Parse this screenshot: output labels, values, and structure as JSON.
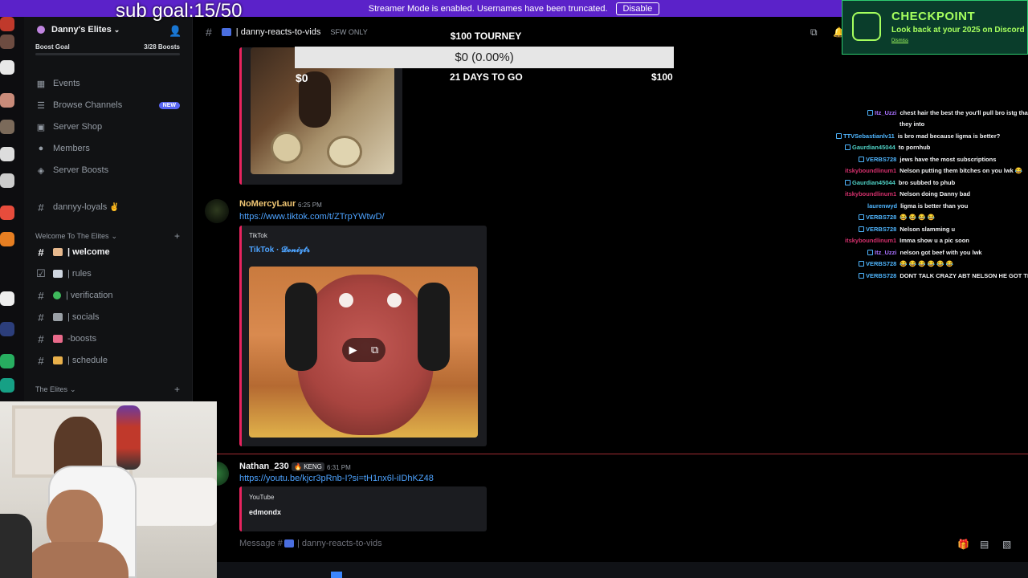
{
  "banner": {
    "text": "Streamer Mode is enabled. Usernames have been truncated.",
    "disable_label": "Disable"
  },
  "overlay": {
    "sub_goal": "sub goal:15/50",
    "tourney_title": "$100 TOURNEY",
    "tourney_amount": "$0 (0.00%)",
    "tourney_min": "$0",
    "tourney_days": "21 DAYS TO GO",
    "tourney_max": "$100"
  },
  "server": {
    "name": "Danny's Elites",
    "boost_goal_label": "Boost Goal",
    "boost_count": "3/28 Boosts",
    "nav": [
      {
        "label": "Events",
        "icon": "calendar-icon"
      },
      {
        "label": "Browse Channels",
        "icon": "browse-icon",
        "badge": "NEW"
      },
      {
        "label": "Server Shop",
        "icon": "shop-icon"
      },
      {
        "label": "Members",
        "icon": "members-icon"
      },
      {
        "label": "Server Boosts",
        "icon": "boost-icon"
      }
    ],
    "loyals_channel": "dannyy-loyals",
    "category_welcome": "Welcome To The Elites",
    "channels": [
      {
        "label": "| welcome",
        "active": true,
        "emoji_color": "#e7b98e"
      },
      {
        "label": "| rules",
        "emoji_color": "#cfd6e0"
      },
      {
        "label": "| verification",
        "emoji_color": "#3fba5d"
      },
      {
        "label": "| socials",
        "emoji_color": "#9aa0a6"
      },
      {
        "label": "-boosts",
        "emoji_color": "#e96a8a"
      },
      {
        "label": "| schedule",
        "emoji_color": "#e9b04a"
      }
    ],
    "category_elites": "The Elites"
  },
  "header": {
    "channel_name": "| danny-reacts-to-vids",
    "sfw": "SFW ONLY"
  },
  "messages": [
    {
      "author": "NoMercyLaur",
      "author_color": "#f0c674",
      "time": "6:25 PM",
      "link": "https://www.tiktok.com/t/ZTrpYWtwD/",
      "embed_provider": "TikTok",
      "embed_title": "TikTok · 𝓓𝓸𝓷𝓲𝔃𝓽𝓻"
    },
    {
      "author": "Nathan_230",
      "author_color": "#f2f3f5",
      "tag": "KENG",
      "time": "6:31 PM",
      "link": "https://youtu.be/kjcr3pRnb-I?si=tH1nx6l-iIDhKZ48",
      "embed_provider": "YouTube",
      "embed_title": "edmondx"
    }
  ],
  "composer": {
    "placeholder": "Message #",
    "channel": "| danny-reacts-to-vids"
  },
  "checkpoint": {
    "title": "CHECKPOINT",
    "subtitle": "Look back at your 2025 on Discord",
    "dismiss": "Dismiss"
  },
  "chat": [
    {
      "user": "Itz_Uzzi",
      "color": "#a970ff",
      "badge": true,
      "msg": "chest hair the best the you'll pull bro istg thats"
    },
    {
      "user": "",
      "color": "#f2f3f5",
      "badge": false,
      "msg": "they into"
    },
    {
      "user": "TTVSebastianlv11",
      "color": "#4fb6ff",
      "badge": true,
      "msg": "is bro mad because ligma is better?"
    },
    {
      "user": "Gaurdian45044",
      "color": "#4fd1c5",
      "badge": true,
      "msg": "to pornhub"
    },
    {
      "user": "VERBS728",
      "color": "#4fb6ff",
      "badge": true,
      "msg": "jews have the most subscriptions"
    },
    {
      "user": "itskyboundlinum1",
      "color": "#d4306c",
      "badge": false,
      "msg": "Nelson putting them bitches on you lwk 😂"
    },
    {
      "user": "Gaurdian45044",
      "color": "#4fd1c5",
      "badge": true,
      "msg": "bro subbed to phub"
    },
    {
      "user": "itskyboundlinum1",
      "color": "#d4306c",
      "badge": false,
      "msg": "Nelson doing Danny bad"
    },
    {
      "user": "laurenwyd",
      "color": "#4fb6ff",
      "badge": false,
      "msg": "ligma is better than you"
    },
    {
      "user": "VERBS728",
      "color": "#4fb6ff",
      "badge": true,
      "msg": "😂 😂 😂 😂"
    },
    {
      "user": "VERBS728",
      "color": "#4fb6ff",
      "badge": true,
      "msg": "Nelson slamming u"
    },
    {
      "user": "itskyboundlinum1",
      "color": "#d4306c",
      "badge": false,
      "msg": "Imma show u a pic soon"
    },
    {
      "user": "Itz_Uzzi",
      "color": "#a970ff",
      "badge": true,
      "msg": "nelson got beef with you lwk"
    },
    {
      "user": "VERBS728",
      "color": "#4fb6ff",
      "badge": true,
      "msg": "😂 😂 😂 😂 😂 😂"
    },
    {
      "user": "VERBS728",
      "color": "#4fb6ff",
      "badge": true,
      "msg": "DONT TALK CRAZY ABT NELSON HE GOT TIES"
    }
  ]
}
